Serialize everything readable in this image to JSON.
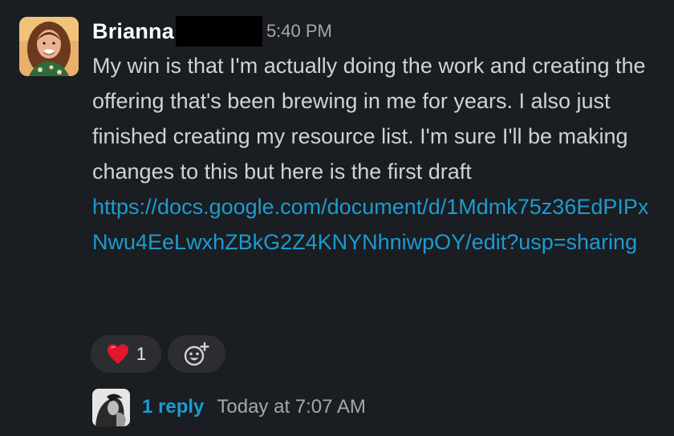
{
  "message": {
    "author": "Brianna",
    "timestamp": "5:40 PM",
    "text": "My win is that I'm actually doing the work and creating the offering that's been brewing in me for years. I also just finished creating my resource list. I'm sure I'll be making changes to this but here is the first draft",
    "link": "https://docs.google.com/document/d/1Mdmk75z36EdPIPxNwu4EeLwxhZBkG2Z4KNYNhniwpOY/edit?usp=sharing"
  },
  "reactions": [
    {
      "emoji": "❤️",
      "icon": "red-heart-icon",
      "count": "1"
    }
  ],
  "add_reaction": {
    "icon": "add-emoji-icon"
  },
  "thread": {
    "reply_count": "1 reply",
    "last_reply": "Today at 7:07 AM"
  },
  "colors": {
    "background": "#1a1d21",
    "link": "#1d9bd1",
    "text": "#d1d2d3",
    "muted": "#a6a7a9",
    "heart": "#e0182d",
    "redaction": "#000000"
  }
}
